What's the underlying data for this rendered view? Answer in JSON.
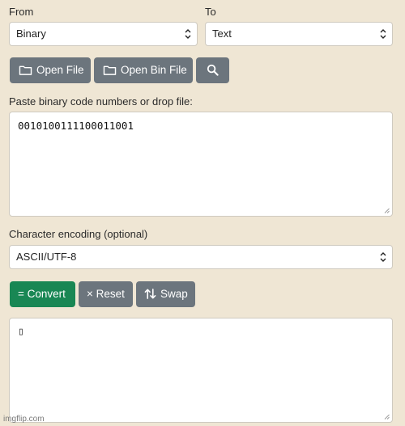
{
  "from": {
    "label": "From",
    "selected": "Binary"
  },
  "to": {
    "label": "To",
    "selected": "Text"
  },
  "toolbar": {
    "open_file": "Open File",
    "open_bin_file": "Open Bin File",
    "search_icon": "search-icon"
  },
  "input": {
    "label": "Paste binary code numbers or drop file:",
    "value": "0010100111100011001"
  },
  "encoding": {
    "label": "Character encoding (optional)",
    "selected": "ASCII/UTF-8"
  },
  "actions": {
    "convert": "= Convert",
    "reset": "× Reset",
    "swap": "Swap"
  },
  "output": {
    "value": "▯"
  },
  "watermark": "imgflip.com",
  "colors": {
    "background": "#efe6d4",
    "button_gray": "#6c757d",
    "button_green": "#198754"
  }
}
